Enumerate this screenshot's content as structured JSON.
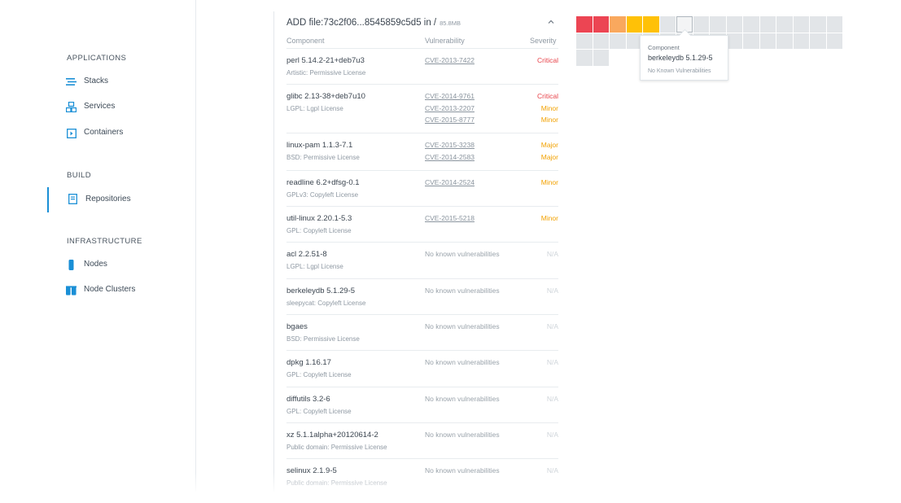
{
  "sidebar": {
    "sections": [
      {
        "title": "APPLICATIONS",
        "items": [
          {
            "label": "Stacks",
            "icon": "stacks-icon"
          },
          {
            "label": "Services",
            "icon": "services-icon"
          },
          {
            "label": "Containers",
            "icon": "containers-icon"
          }
        ]
      },
      {
        "title": "BUILD",
        "items": [
          {
            "label": "Repositories",
            "icon": "repositories-icon",
            "active": true
          }
        ]
      },
      {
        "title": "INFRASTRUCTURE",
        "items": [
          {
            "label": "Nodes",
            "icon": "nodes-icon"
          },
          {
            "label": "Node Clusters",
            "icon": "node-clusters-icon"
          }
        ]
      }
    ]
  },
  "layer": {
    "title": "ADD file:73c2f06...8545859c5d5 in /",
    "size": "85.8MB",
    "columns": {
      "component": "Component",
      "vulnerability": "Vulnerability",
      "severity": "Severity"
    }
  },
  "components": [
    {
      "name": "perl 5.14.2-21+deb7u3",
      "license": "Artistic: Permissive License",
      "vulns": [
        {
          "id": "CVE-2013-7422",
          "severity": "Critical"
        }
      ]
    },
    {
      "name": "glibc 2.13-38+deb7u10",
      "license": "LGPL: Lgpl License",
      "vulns": [
        {
          "id": "CVE-2014-9761",
          "severity": "Critical"
        },
        {
          "id": "CVE-2013-2207",
          "severity": "Minor"
        },
        {
          "id": "CVE-2015-8777",
          "severity": "Minor"
        }
      ]
    },
    {
      "name": "linux-pam 1.1.3-7.1",
      "license": "BSD: Permissive License",
      "vulns": [
        {
          "id": "CVE-2015-3238",
          "severity": "Major"
        },
        {
          "id": "CVE-2014-2583",
          "severity": "Major"
        }
      ]
    },
    {
      "name": "readline 6.2+dfsg-0.1",
      "license": "GPLv3: Copyleft License",
      "vulns": [
        {
          "id": "CVE-2014-2524",
          "severity": "Minor"
        }
      ]
    },
    {
      "name": "util-linux 2.20.1-5.3",
      "license": "GPL: Copyleft License",
      "vulns": [
        {
          "id": "CVE-2015-5218",
          "severity": "Minor"
        }
      ]
    },
    {
      "name": "acl 2.2.51-8",
      "license": "LGPL: Lgpl License",
      "none": "No known vulnerabilities",
      "severity": "N/A"
    },
    {
      "name": "berkeleydb 5.1.29-5",
      "license": "sleepycat: Copyleft License",
      "none": "No known vulnerabilities",
      "severity": "N/A"
    },
    {
      "name": "bgaes",
      "license": "BSD: Permissive License",
      "none": "No known vulnerabilities",
      "severity": "N/A"
    },
    {
      "name": "dpkg 1.16.17",
      "license": "GPL: Copyleft License",
      "none": "No known vulnerabilities",
      "severity": "N/A"
    },
    {
      "name": "diffutils 3.2-6",
      "license": "GPL: Copyleft License",
      "none": "No known vulnerabilities",
      "severity": "N/A"
    },
    {
      "name": "xz 5.1.1alpha+20120614-2",
      "license": "Public domain: Permissive License",
      "none": "No known vulnerabilities",
      "severity": "N/A"
    },
    {
      "name": "selinux 2.1.9-5",
      "license": "Public domain: Permissive License",
      "none": "No known vulnerabilities",
      "severity": "N/A"
    }
  ],
  "heatmap": {
    "cells": [
      "critical",
      "critical",
      "minor",
      "major",
      "major",
      "none",
      "selected",
      "none",
      "none",
      "none",
      "none",
      "none",
      "none",
      "none",
      "none",
      "none",
      "none",
      "none",
      "none",
      "none",
      "none",
      "none",
      "none",
      "none",
      "none",
      "none",
      "none",
      "none",
      "none",
      "none",
      "none",
      "none",
      "none",
      "none"
    ],
    "colors": {
      "critical": "#ec4553",
      "minor": "#f9a85e",
      "major": "#ffc107",
      "none": "#e2e5e8",
      "selected": "#f3f4f5"
    },
    "tooltip": {
      "heading": "Component",
      "name": "berkeleydb 5.1.29-5",
      "description": "No Known Vulnerabilities"
    }
  }
}
